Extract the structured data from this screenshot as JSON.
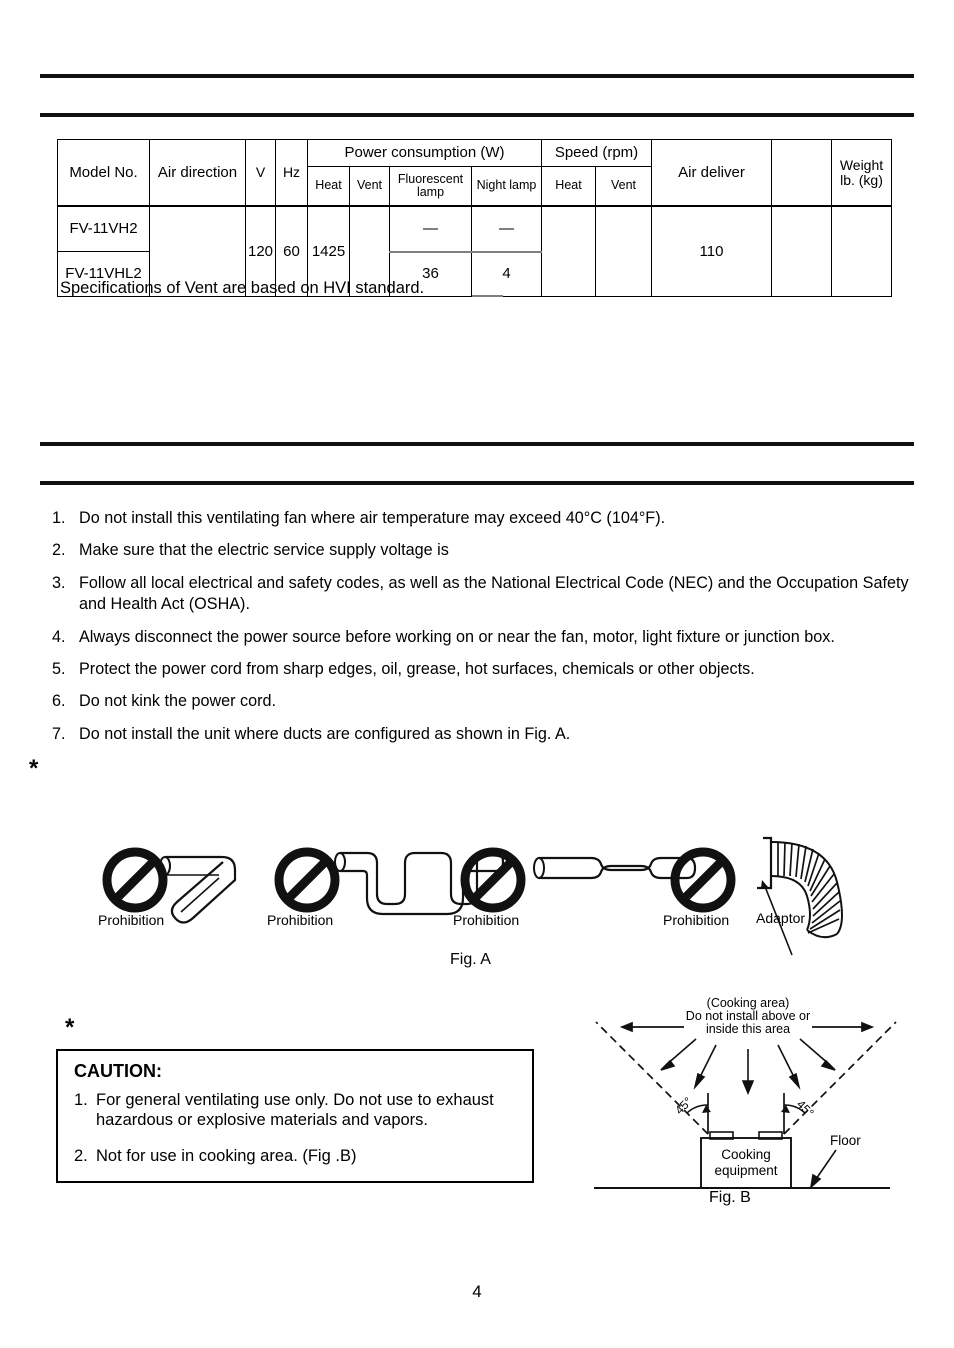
{
  "page": {
    "number": "4"
  },
  "spec_table": {
    "headers": {
      "model_no": "Model No.",
      "air_direction": "Air direction",
      "volts": "V",
      "hertz": "Hz",
      "power_consumption": "Power consumption (W)",
      "power_heat": "Heat",
      "power_vent": "Vent",
      "fluorescent_lamp_line1": "Fluorescent",
      "fluorescent_lamp_line2": "lamp",
      "night_lamp": "Night lamp",
      "speed": "Speed (rpm)",
      "speed_heat": "Heat",
      "speed_vent": "Vent",
      "air_deliver": "Air deliver",
      "blank_col": "",
      "weight_line1": "Weight",
      "weight_line2": "lb. (kg)"
    },
    "rows": [
      {
        "model_no": "FV-11VH2",
        "air_direction": "",
        "volts": "120",
        "hertz": "60",
        "power_heat": "1425",
        "power_vent": "",
        "fluorescent_lamp": "—",
        "night_lamp": "—",
        "speed_heat": "",
        "speed_vent": "",
        "air_deliver": "110",
        "blank_col": "",
        "weight": ""
      },
      {
        "model_no": "FV-11VHL2",
        "air_direction": "",
        "volts": "",
        "hertz": "",
        "power_heat": "",
        "power_vent": "",
        "fluorescent_lamp": "36",
        "night_lamp": "4",
        "speed_heat": "",
        "speed_vent": "",
        "air_deliver": "",
        "blank_col": "",
        "weight": ""
      }
    ],
    "note": "Specifications of Vent are based on HVI standard."
  },
  "warnings": [
    {
      "num": "1.",
      "text": "Do not install this ventilating fan where air temperature may exceed 40°C (104°F)."
    },
    {
      "num": "2.",
      "text": "Make sure that the electric service supply voltage is"
    },
    {
      "num": "3.",
      "text": "Follow all local electrical and safety codes, as well as the National Electrical Code (NEC) and the Occupation Safety and Health Act (OSHA)."
    },
    {
      "num": "4.",
      "text": "Always disconnect the power source before working on or near the fan, motor, light fixture or junction box."
    },
    {
      "num": "5.",
      "text": "Protect the power cord from sharp edges, oil, grease, hot surfaces, chemicals or other objects."
    },
    {
      "num": "6.",
      "text": "Do not kink the power cord."
    },
    {
      "num": "7.",
      "text": "Do not install the unit where ducts are configured as shown in Fig. A."
    }
  ],
  "markers": {
    "asterisk_1": "*",
    "asterisk_2": "*"
  },
  "figure_a": {
    "caption": "Fig. A",
    "items": [
      {
        "label": "Prohibition",
        "icon": "prohibition-icon",
        "duct": "sharp-bend-duct"
      },
      {
        "label": "Prohibition",
        "icon": "prohibition-icon",
        "duct": "sagging-duct"
      },
      {
        "label": "Prohibition",
        "icon": "prohibition-icon",
        "duct": "crushed-duct"
      },
      {
        "label": "Prohibition",
        "icon": "prohibition-icon",
        "duct": "flexible-duct-adaptor"
      }
    ],
    "adaptor_label": "Adaptor"
  },
  "caution": {
    "title": "CAUTION:",
    "items": [
      {
        "num": "1.",
        "text": "For general ventilating use only. Do not use to exhaust hazardous or explosive materials and vapors."
      },
      {
        "num": "2.",
        "text": "Not for use in cooking area. (Fig .B)"
      }
    ]
  },
  "figure_b": {
    "caption": "Fig. B",
    "title_line1": "(Cooking area)",
    "title_line2": "Do not install above or",
    "title_line3": "inside this area",
    "angle_left": "45°",
    "angle_right": "45°",
    "equipment_line1": "Cooking",
    "equipment_line2": "equipment",
    "floor_label": "Floor"
  },
  "colors": {
    "ink": "#000000",
    "rule": "#111111",
    "gray_rule": "#808080",
    "paper": "#ffffff"
  }
}
